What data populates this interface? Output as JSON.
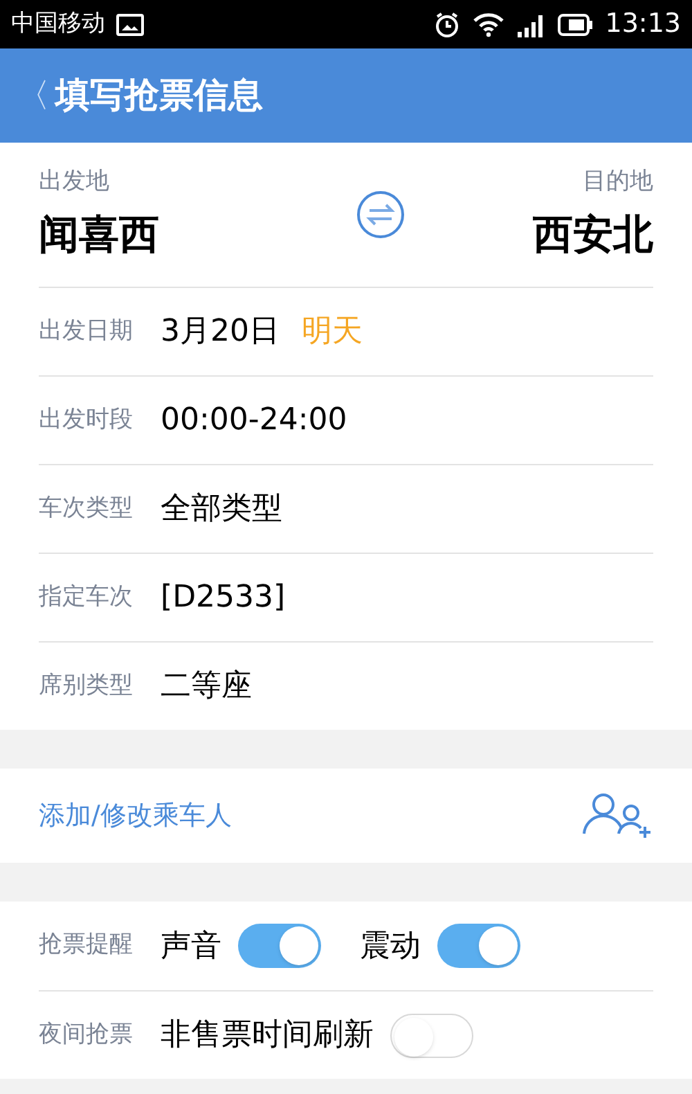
{
  "status_bar": {
    "carrier": "中国移动",
    "time": "13:13"
  },
  "header": {
    "back": "〈",
    "title": "填写抢票信息"
  },
  "route": {
    "from_label": "出发地",
    "from": "闻喜西",
    "to_label": "目的地",
    "to": "西安北"
  },
  "fields": [
    {
      "label": "出发日期",
      "value": "3月20日",
      "note": "明天"
    },
    {
      "label": "出发时段",
      "value": "00:00-24:00"
    },
    {
      "label": "车次类型",
      "value": "全部类型"
    },
    {
      "label": "指定车次",
      "value": "[D2533]"
    },
    {
      "label": "席别类型",
      "value": "二等座"
    }
  ],
  "passenger": {
    "label": "添加/修改乘车人"
  },
  "options": [
    {
      "label": "抢票提醒",
      "toggles": [
        {
          "label": "声音",
          "on": true
        },
        {
          "label": "震动",
          "on": true
        }
      ]
    },
    {
      "label": "夜间抢票",
      "toggles": [
        {
          "label": "非售票时间刷新",
          "on": false
        }
      ]
    }
  ]
}
